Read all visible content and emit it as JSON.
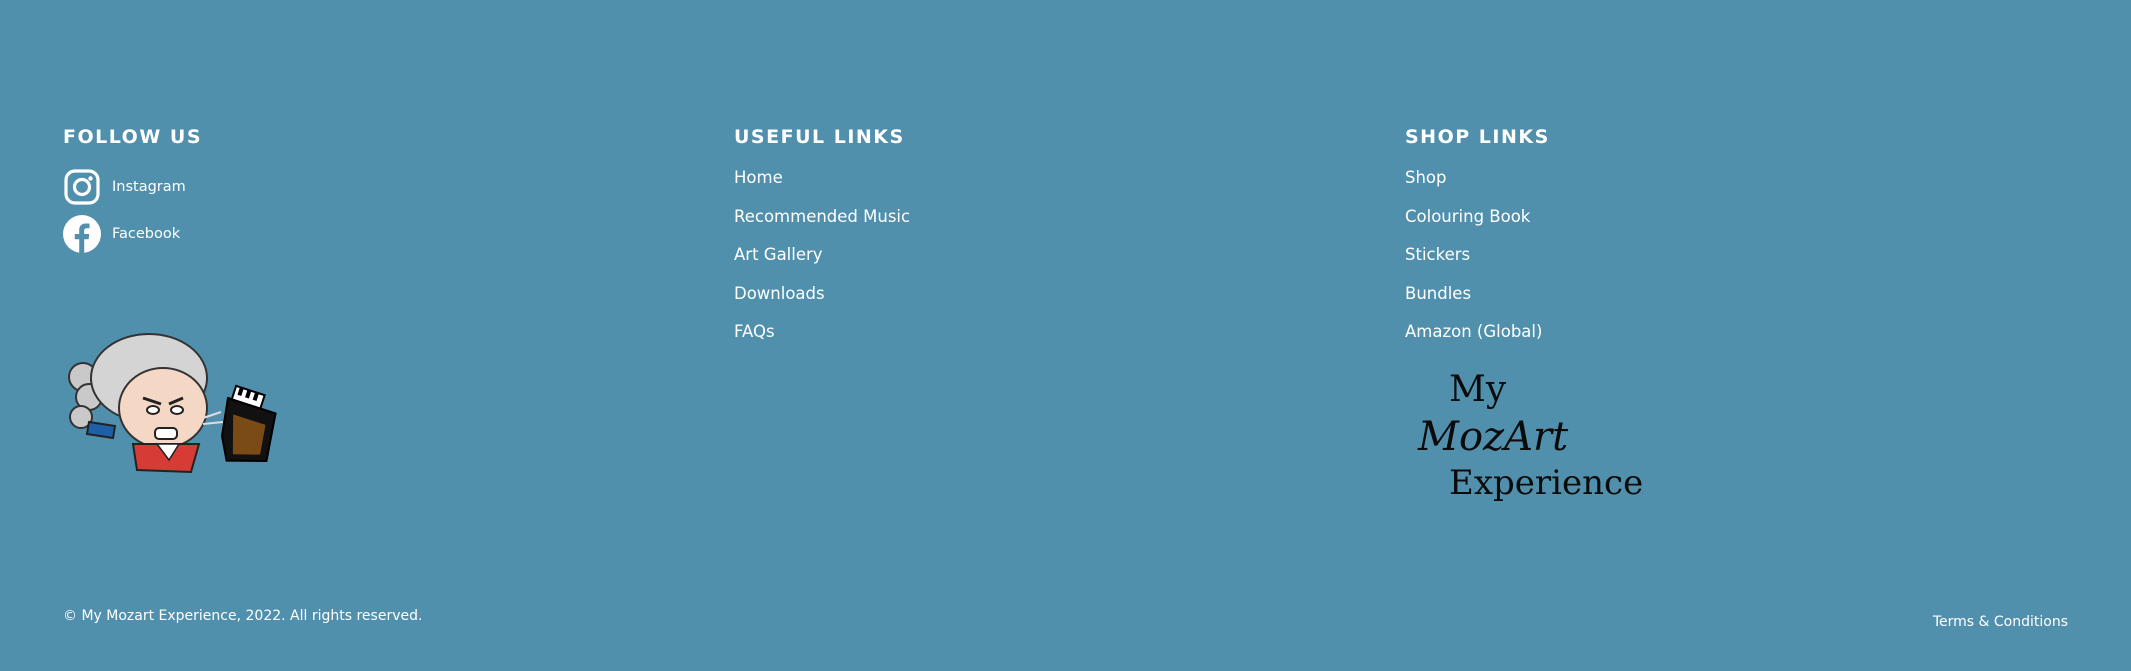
{
  "follow": {
    "heading": "FOLLOW US",
    "instagram_label": "Instagram",
    "facebook_label": "Facebook"
  },
  "useful": {
    "heading": "USEFUL LINKS",
    "links": [
      "Home",
      "Recommended Music",
      "Art Gallery",
      "Downloads",
      "FAQs"
    ]
  },
  "shop": {
    "heading": "SHOP LINKS",
    "links": [
      "Shop",
      "Colouring Book",
      "Stickers",
      "Bundles",
      "Amazon (Global)"
    ]
  },
  "logo": {
    "line1": "My",
    "line2": "MozArt",
    "line3": "Experience"
  },
  "footer": {
    "copyright": "© My Mozart Experience, 2022. All rights reserved.",
    "terms": "Terms & Conditions"
  },
  "colors": {
    "background": "#5190ad",
    "text": "#ffffff",
    "logo_text": "#0b0b0b"
  },
  "icons": [
    "instagram-icon",
    "facebook-icon"
  ]
}
